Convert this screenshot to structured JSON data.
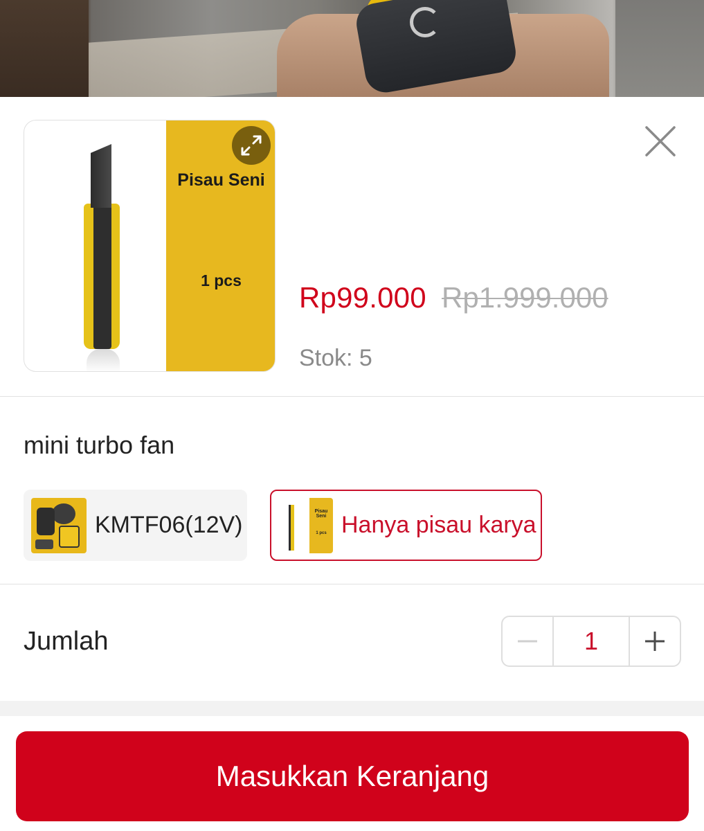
{
  "product": {
    "image_label_title": "Pisau Seni",
    "image_label_qty": "1 pcs",
    "price": "Rp99.000",
    "original_price": "Rp1.999.000",
    "stock": "Stok: 5"
  },
  "variant": {
    "title": "mini turbo fan",
    "options": [
      {
        "label": "KMTF06(12V)",
        "selected": false
      },
      {
        "label": "Hanya pisau karya",
        "selected": true
      }
    ],
    "thumb_selected_title": "Pisau Seni",
    "thumb_selected_qty": "1 pcs"
  },
  "quantity": {
    "label": "Jumlah",
    "value": "1",
    "minus_symbol": "−",
    "plus_symbol": "+"
  },
  "actions": {
    "add_to_cart": "Masukkan Keranjang"
  },
  "icons": {
    "expand": "expand-arrows-icon",
    "close": "close-icon"
  },
  "colors": {
    "accent": "#d0021b",
    "selected_border": "#c9102b",
    "product_yellow": "#e7b81f"
  }
}
